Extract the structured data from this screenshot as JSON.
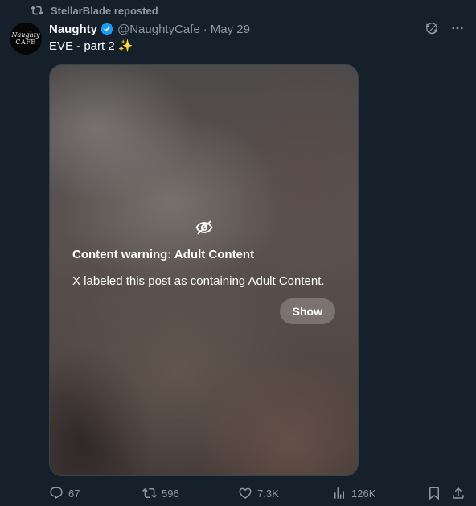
{
  "repost": {
    "text": "StellarBlade reposted",
    "icon": "repost-icon"
  },
  "author": {
    "display_name": "Naughty",
    "handle": "@NaughtyCafe",
    "separator": "·",
    "time": "May 29",
    "verified": true,
    "avatar_text_top": "Naughty",
    "avatar_text_bottom": "CAFE"
  },
  "post": {
    "text": "EVE - part 2",
    "emoji": "✨"
  },
  "media": {
    "warning_title": "Content warning: Adult Content",
    "warning_desc": "X labeled this post as containing Adult Content.",
    "show_label": "Show",
    "icon": "eye-off-icon"
  },
  "actions": {
    "replies": "67",
    "reposts": "596",
    "likes": "7.3K",
    "views": "126K"
  },
  "colors": {
    "background": "#15202b",
    "secondary_text": "#8b98a5",
    "verified_blue": "#1d9bf0",
    "primary_text": "#f7f9f9"
  }
}
